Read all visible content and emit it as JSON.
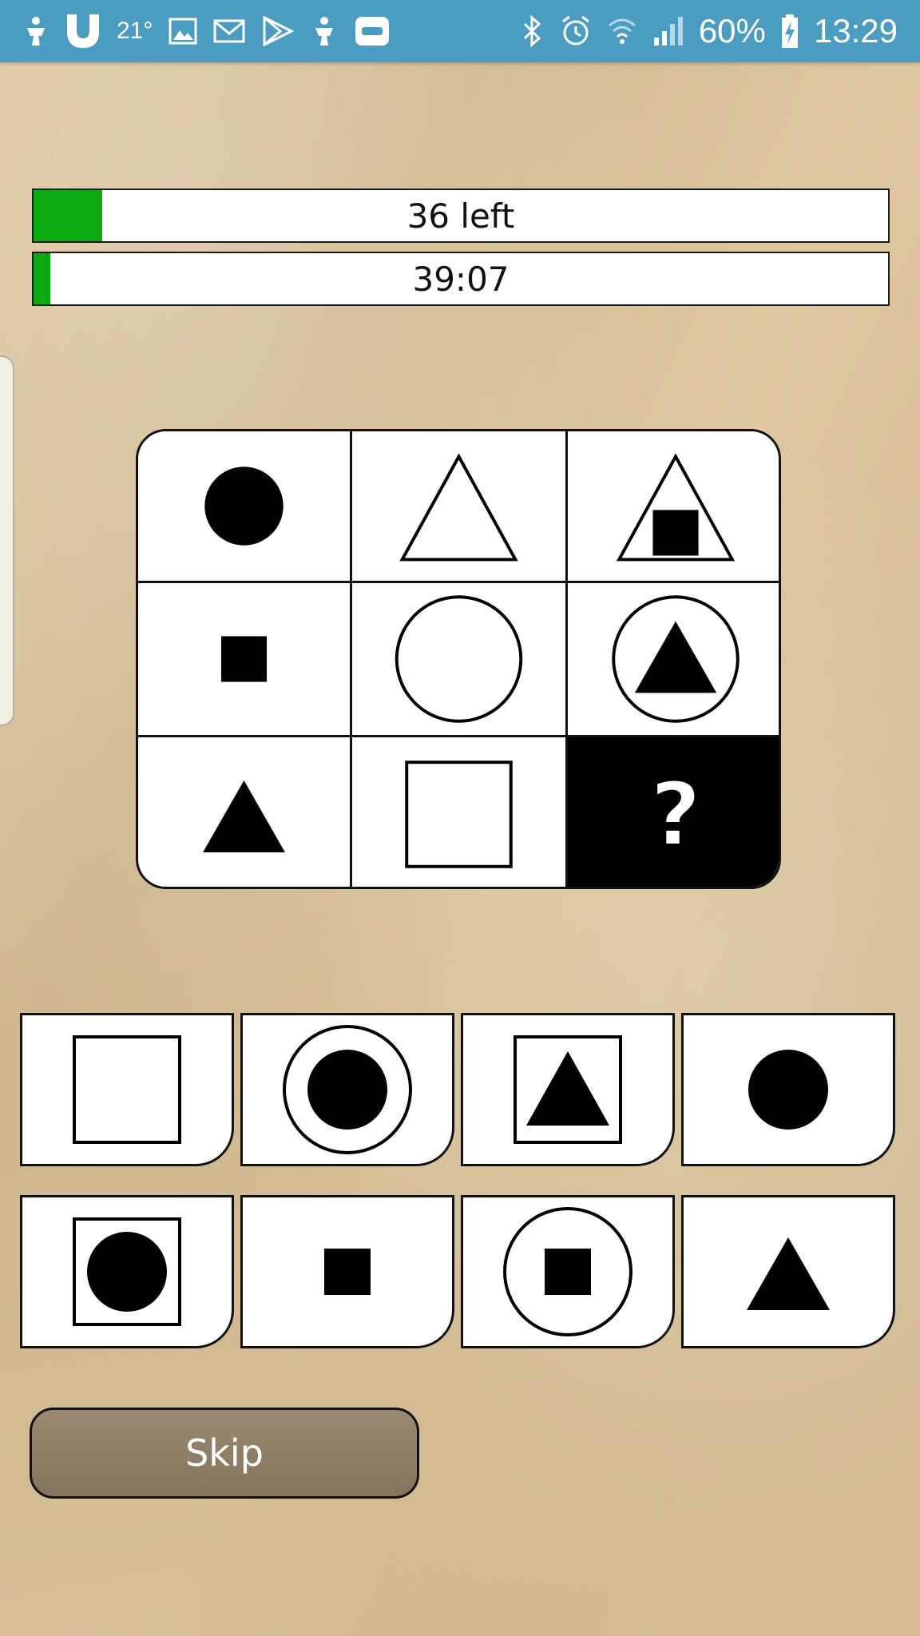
{
  "status_bar": {
    "temperature": "21°",
    "battery_percent": "60%",
    "time": "13:29",
    "icons_left": [
      "usb-icon",
      "u-badge-icon",
      "image-icon",
      "mail-icon",
      "play-store-icon",
      "usb-icon",
      "record-icon"
    ],
    "icons_right": [
      "bluetooth-icon",
      "alarm-icon",
      "wifi-icon",
      "signal-icon",
      "battery-charging-icon"
    ]
  },
  "progress": {
    "remaining_label": "36 left",
    "remaining_fill_fraction": 0.08,
    "timer_label": "39:07",
    "timer_fill_fraction": 0.02,
    "fill_color": "#0aaa10"
  },
  "puzzle": {
    "rows": [
      [
        {
          "shape": "filled-circle"
        },
        {
          "shape": "outline-triangle"
        },
        {
          "shape": "outline-triangle-with-filled-square"
        }
      ],
      [
        {
          "shape": "small-filled-square"
        },
        {
          "shape": "outline-circle"
        },
        {
          "shape": "outline-circle-with-filled-triangle"
        }
      ],
      [
        {
          "shape": "filled-triangle"
        },
        {
          "shape": "outline-square"
        },
        {
          "shape": "question-mark",
          "text": "?"
        }
      ]
    ]
  },
  "answers": [
    {
      "shape": "outline-square"
    },
    {
      "shape": "outline-circle-with-filled-circle"
    },
    {
      "shape": "outline-square-with-filled-triangle"
    },
    {
      "shape": "filled-circle"
    },
    {
      "shape": "outline-square-with-filled-circle"
    },
    {
      "shape": "small-filled-square"
    },
    {
      "shape": "outline-circle-with-filled-square"
    },
    {
      "shape": "filled-triangle"
    }
  ],
  "skip_button": {
    "label": "Skip"
  }
}
